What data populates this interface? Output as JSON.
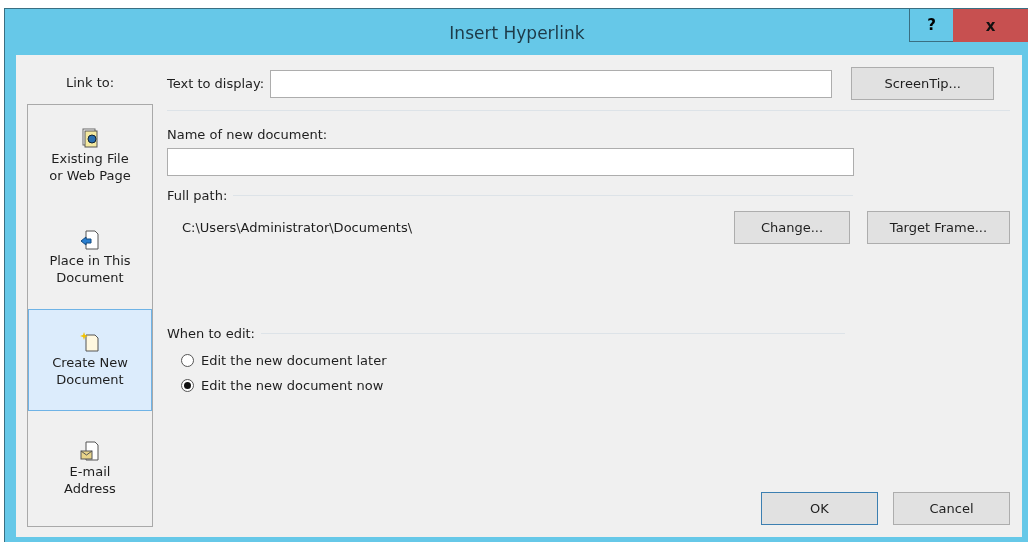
{
  "window": {
    "title": "Insert Hyperlink",
    "help": "?",
    "close": "x"
  },
  "link_to": {
    "label": "Link to:",
    "items": [
      {
        "kind": "file",
        "label": "Existing File\nor Web Page",
        "selected": false
      },
      {
        "kind": "place",
        "label": "Place in This\nDocument",
        "selected": false
      },
      {
        "kind": "new",
        "label": "Create New\nDocument",
        "selected": true
      },
      {
        "kind": "email",
        "label": "E-mail\nAddress",
        "selected": false
      }
    ]
  },
  "text_to_display": {
    "label": "Text to display:"
  },
  "screentip_button": "ScreenTip...",
  "name_of_new_document": {
    "label": "Name of new document:"
  },
  "full_path": {
    "label": "Full path:",
    "value": "C:\\Users\\Administrator\\Documents\\"
  },
  "change_button": "Change...",
  "target_frame_button": "Target Frame...",
  "when_to_edit": {
    "label": "When to edit:",
    "options": [
      {
        "label": "Edit the new document later",
        "selected": false
      },
      {
        "label": "Edit the new document now",
        "selected": true
      }
    ]
  },
  "buttons": [
    {
      "label": "OK",
      "default": true
    },
    {
      "label": "Cancel",
      "default": false
    }
  ]
}
